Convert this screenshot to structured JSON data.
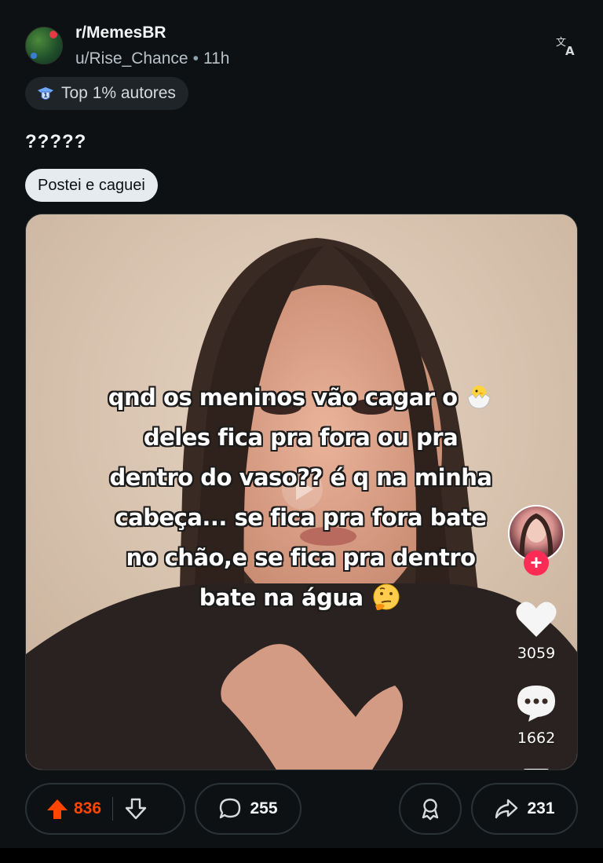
{
  "post": {
    "subreddit": "r/MemesBR",
    "author": "u/Rise_Chance",
    "separator": "•",
    "age": "11h",
    "author_badge": "Top 1% autores",
    "title": "?????",
    "flair": "Postei e caguei"
  },
  "media": {
    "caption_lines": [
      "qnd os meninos vão cagar o",
      "deles fica pra fora ou pra",
      "dentro do vaso?? é q na minha",
      "cabeça... se fica pra fora bate",
      "no chão,e se fica pra dentro",
      "bate na água"
    ],
    "caption_emojis": [
      "hatching-chick-emoji",
      "thinking-face-emoji"
    ],
    "follow_symbol": "+",
    "likes": "3059",
    "comments": "1662"
  },
  "actions": {
    "upvotes": "836",
    "comments": "255",
    "shares": "231"
  },
  "colors": {
    "background": "#0e1113",
    "upvote_active": "#ff4500",
    "flair_bg": "#e5ebee",
    "tiktok_red": "#fe2c55"
  },
  "icons": {
    "translate": "translate-icon",
    "badge": "top-author-badge-icon",
    "upvote": "upvote-arrow-icon",
    "downvote": "downvote-arrow-icon",
    "comment": "comment-bubble-icon",
    "award": "award-icon",
    "share": "share-arrow-icon",
    "like": "heart-icon",
    "tt_comment": "tiktok-comment-icon"
  }
}
